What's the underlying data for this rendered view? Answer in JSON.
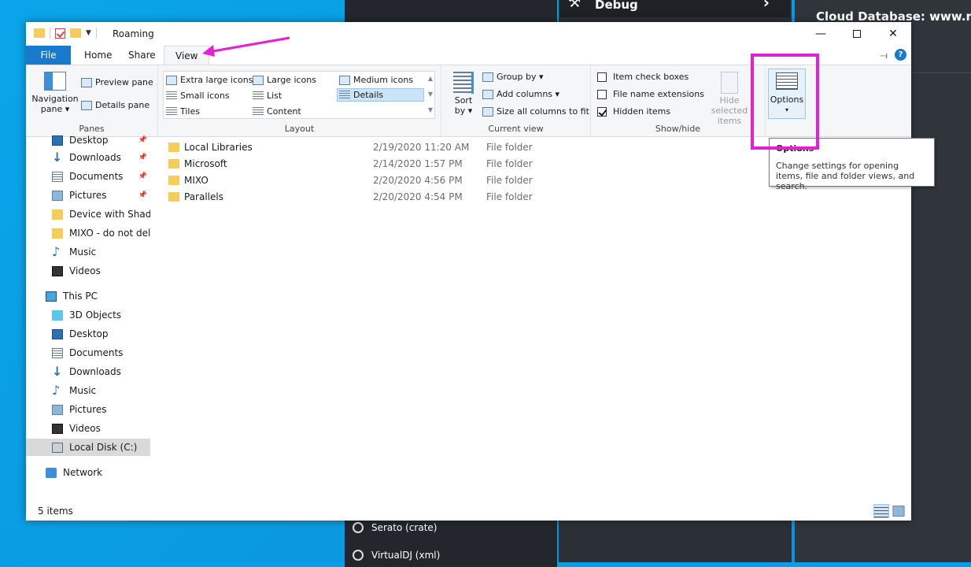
{
  "window": {
    "title": "Roaming",
    "minimize": "—",
    "close": "✕"
  },
  "tabs": {
    "file": "File",
    "home": "Home",
    "share": "Share",
    "view": "View"
  },
  "ribbon": {
    "panes": {
      "label": "Panes",
      "navigation_pane": "Navigation",
      "navigation_pane_2": "pane ▾",
      "preview_pane": "Preview pane",
      "details_pane": "Details pane"
    },
    "layout": {
      "label": "Layout",
      "extra_large_icons": "Extra large icons",
      "large_icons": "Large icons",
      "medium_icons": "Medium icons",
      "small_icons": "Small icons",
      "list": "List",
      "details": "Details",
      "tiles": "Tiles",
      "content": "Content"
    },
    "current_view": {
      "label": "Current view",
      "sort_by": "Sort",
      "sort_by_2": "by ▾",
      "group_by": "Group by ▾",
      "add_columns": "Add columns ▾",
      "size_all_columns": "Size all columns to fit"
    },
    "show_hide": {
      "label": "Show/hide",
      "item_check_boxes": "Item check boxes",
      "file_name_extensions": "File name extensions",
      "hidden_items": "Hidden items",
      "hide_selected": "Hide selected",
      "hide_selected_2": "items"
    },
    "options": {
      "label": "Options",
      "dropdown": "▾"
    }
  },
  "nav_pane": {
    "items": [
      {
        "label": "Desktop",
        "icon": "desktop-icon",
        "pinned": true
      },
      {
        "label": "Downloads",
        "icon": "downloads-icon",
        "pinned": true
      },
      {
        "label": "Documents",
        "icon": "documents-icon",
        "pinned": true
      },
      {
        "label": "Pictures",
        "icon": "pictures-icon",
        "pinned": true
      },
      {
        "label": "Device with Shadow",
        "icon": "folder-icon",
        "pinned": false
      },
      {
        "label": "MIXO - do not delet",
        "icon": "folder-icon",
        "pinned": false
      },
      {
        "label": "Music",
        "icon": "music-icon",
        "pinned": false
      },
      {
        "label": "Videos",
        "icon": "videos-icon",
        "pinned": false
      },
      {
        "label": "This PC",
        "icon": "this-pc-icon",
        "pinned": false
      },
      {
        "label": "3D Objects",
        "icon": "3d-objects-icon",
        "pinned": false
      },
      {
        "label": "Desktop",
        "icon": "desktop-icon",
        "pinned": false
      },
      {
        "label": "Documents",
        "icon": "documents-icon",
        "pinned": false
      },
      {
        "label": "Downloads",
        "icon": "downloads-icon",
        "pinned": false
      },
      {
        "label": "Music",
        "icon": "music-icon",
        "pinned": false
      },
      {
        "label": "Pictures",
        "icon": "pictures-icon",
        "pinned": false
      },
      {
        "label": "Videos",
        "icon": "videos-icon",
        "pinned": false
      },
      {
        "label": "Local Disk (C:)",
        "icon": "local-disk-icon",
        "pinned": false
      },
      {
        "label": "Network",
        "icon": "network-icon",
        "pinned": false
      }
    ]
  },
  "files": [
    {
      "name": "Local Libraries",
      "date": "2/19/2020 11:20 AM",
      "type": "File folder"
    },
    {
      "name": "Microsoft",
      "date": "2/14/2020 1:57 PM",
      "type": "File folder"
    },
    {
      "name": "MIXO",
      "date": "2/20/2020 4:56 PM",
      "type": "File folder"
    },
    {
      "name": "Parallels",
      "date": "2/20/2020 4:54 PM",
      "type": "File folder"
    }
  ],
  "status": {
    "count": "5 items"
  },
  "tooltip": {
    "title": "Options",
    "description": "Change settings for opening items, file and folder views, and search."
  },
  "background_app": {
    "debug": "Debug",
    "cloud_database": "Cloud Database: www.mixo",
    "serato": "Serato (crate)",
    "virtualdj": "VirtualDJ (xml)"
  },
  "colors": {
    "accent": "#1979ca",
    "highlight_annotation": "#e51fd2",
    "folder": "#f5cd5c"
  }
}
